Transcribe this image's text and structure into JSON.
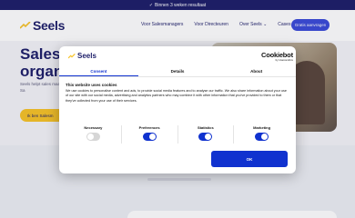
{
  "topbar": {
    "check_icon": "check-icon",
    "text": "Binnen 3 weken resultaat"
  },
  "logo": {
    "text": "Seels"
  },
  "nav": {
    "links": [
      "Voor Salesmanagers",
      "Voor Directeuren",
      "Over Seels ⌄",
      "Cases"
    ],
    "cta": "Gratis aanvragen"
  },
  "hero": {
    "title_line1": "Sales l",
    "title_line2": "organi",
    "subtitle": "Seels helpt sales maar één doel. Sa",
    "button": "Ik ben Salesm"
  },
  "modal": {
    "logo_text": "Seels",
    "cookiebot_main": "Cookiebot",
    "cookiebot_sub": "by Usercentrics",
    "tabs": [
      "Consent",
      "Details",
      "About"
    ],
    "active_tab": "Consent",
    "title": "This website uses cookies",
    "body": "We use cookies to personalise content and ads, to provide social media features and to analyse our traffic. We also share information about your use of our site with our social media, advertising and analytics partners who may combine it with other information that you've provided to them or that they've collected from your use of their services.",
    "categories": [
      {
        "label": "Necessary",
        "enabled": false
      },
      {
        "label": "Preferences",
        "enabled": true
      },
      {
        "label": "Statistics",
        "enabled": true
      },
      {
        "label": "Marketing",
        "enabled": true
      }
    ],
    "ok_button": "OK"
  },
  "colors": {
    "navy": "#1e1f6a",
    "accent_blue": "#1032cf",
    "yellow": "#f7c328"
  }
}
